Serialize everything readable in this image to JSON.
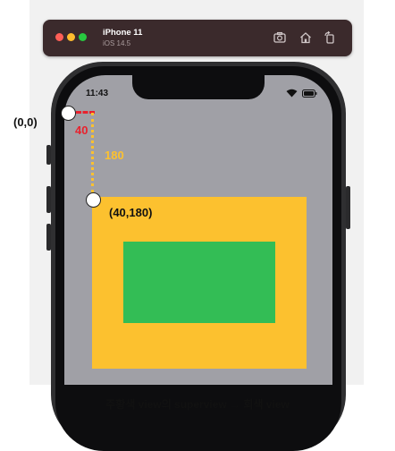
{
  "simulator": {
    "device_name": "iPhone 11",
    "os_version": "iOS 14.5",
    "toolbar_icons": [
      "screenshot-icon",
      "home-icon",
      "rotate-icon"
    ]
  },
  "status_bar": {
    "time": "11:43",
    "icons": [
      "wifi-icon",
      "battery-icon"
    ]
  },
  "annotations": {
    "origin_label": "(0,0)",
    "x_offset_label": "40",
    "y_offset_label": "180",
    "point_label": "(40,180)"
  },
  "views": {
    "superview_color": "#a0a0a6",
    "orange_view_color": "#fcc12f",
    "green_view_color": "#33bd55"
  },
  "caption": "주황색 view의 superview → 회색 view"
}
